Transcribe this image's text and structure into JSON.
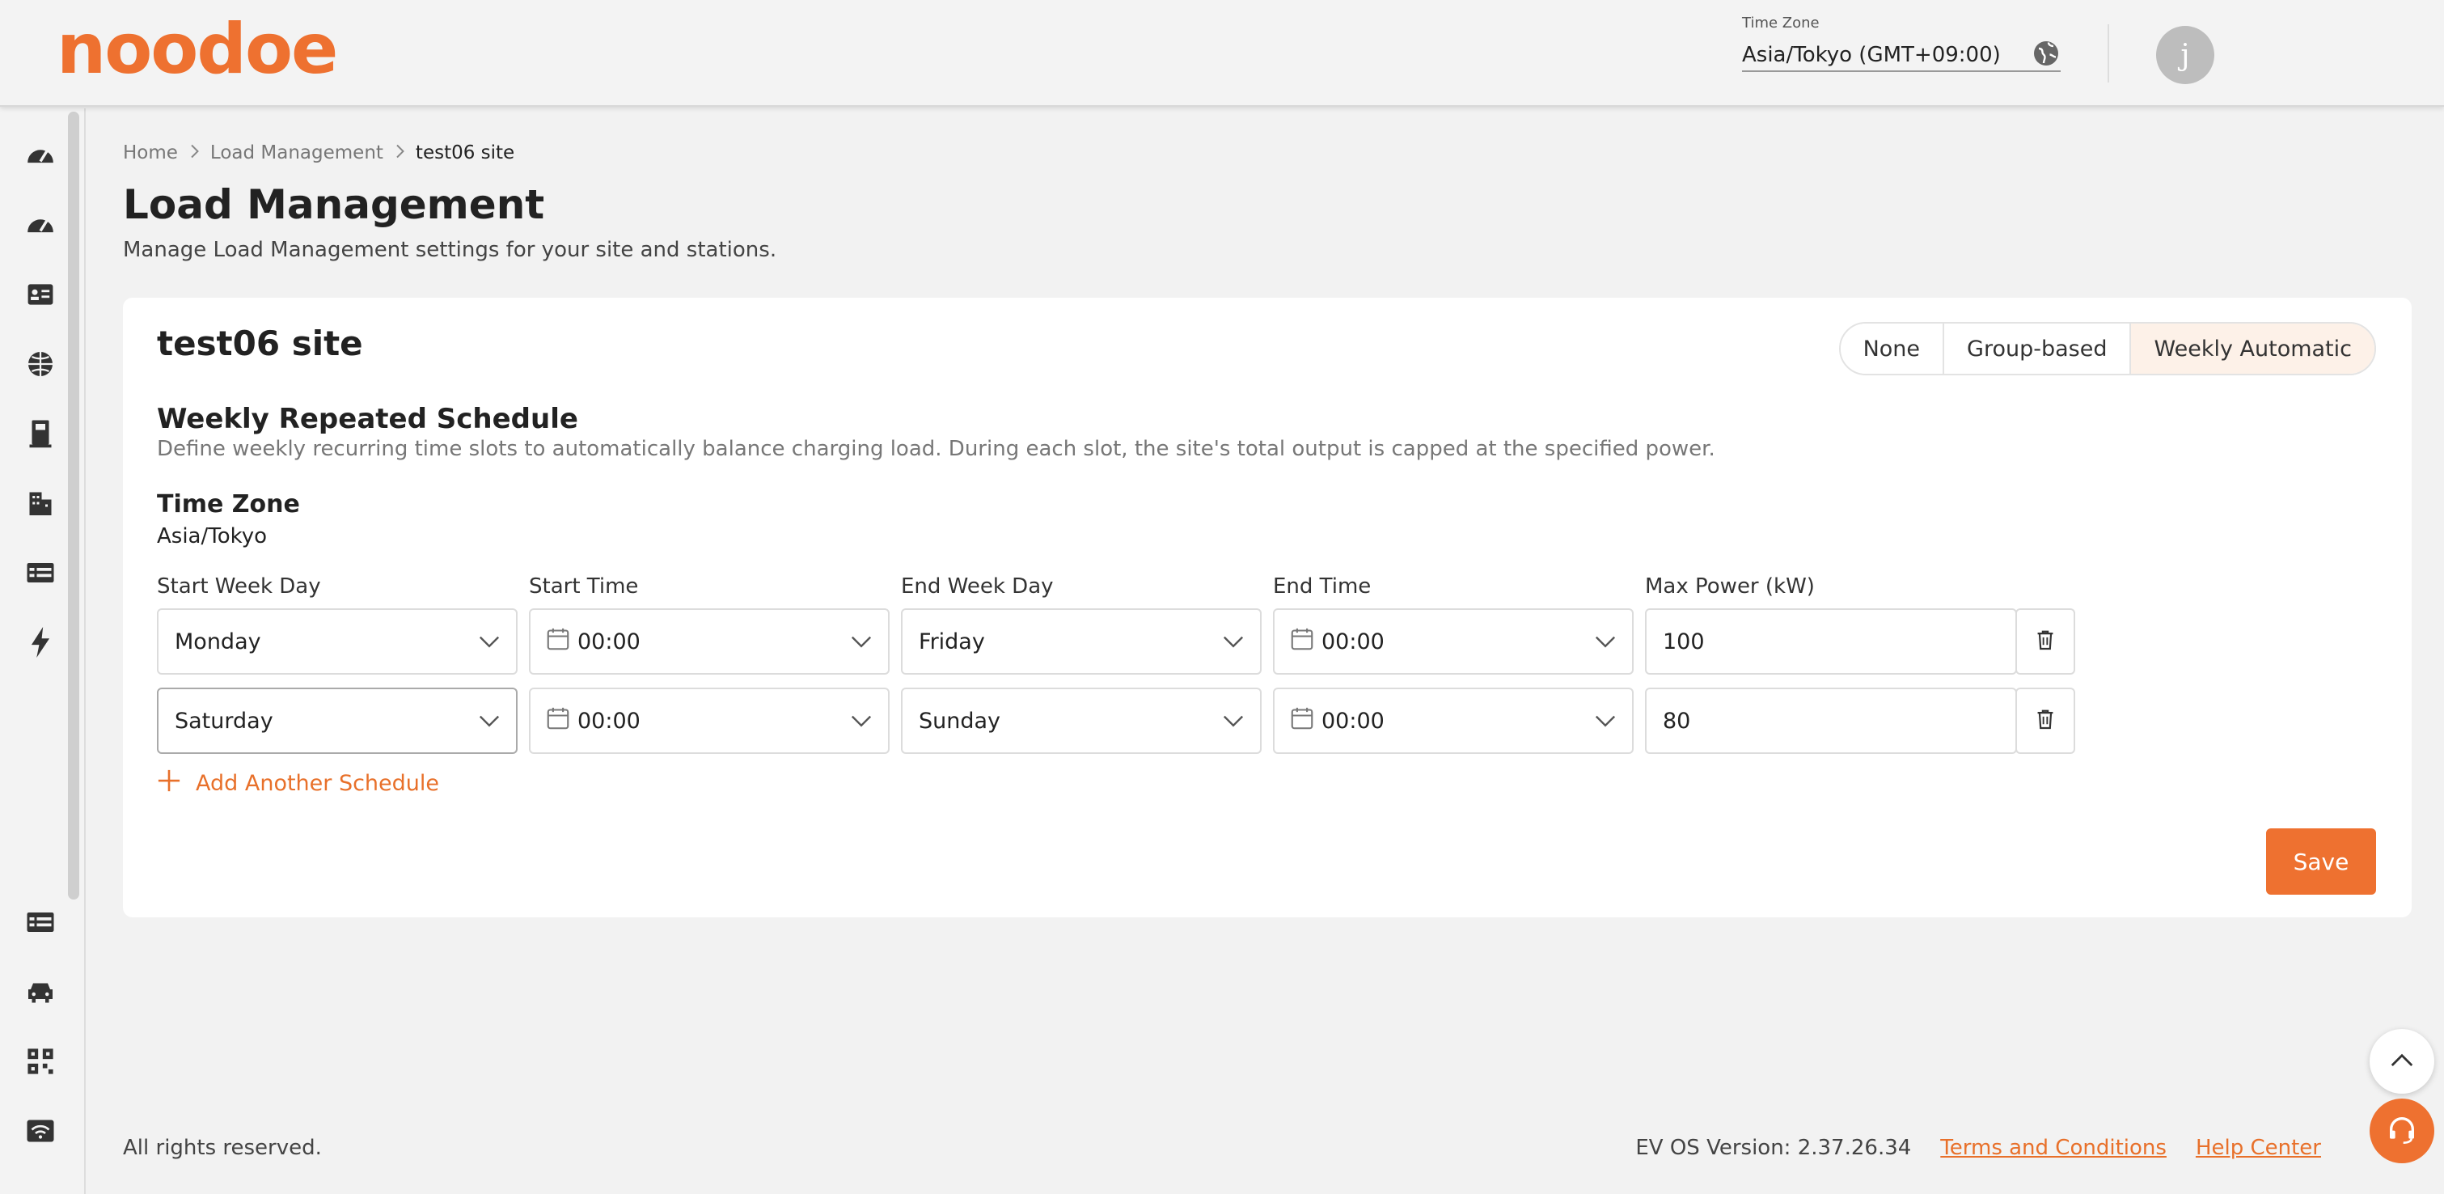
{
  "header": {
    "logo_text": "noodoe",
    "timezone_label": "Time Zone",
    "timezone_value": "Asia/Tokyo (GMT+09:00)",
    "avatar_initial": "j"
  },
  "sidebar": {
    "icons": [
      "dashboard-icon",
      "dashboard-alt-icon",
      "id-card-icon",
      "globe-icon",
      "charger-icon",
      "building-icon",
      "table-icon",
      "lightning-icon",
      "list-icon",
      "car-icon",
      "qr-code-icon",
      "wifi-icon"
    ]
  },
  "breadcrumb": {
    "home": "Home",
    "section": "Load Management",
    "current": "test06 site"
  },
  "page": {
    "title": "Load Management",
    "subtitle": "Manage Load Management settings for your site and stations."
  },
  "card": {
    "site_title": "test06 site",
    "modes": [
      "None",
      "Group-based",
      "Weekly Automatic"
    ],
    "selected_mode": "Weekly Automatic",
    "section_title": "Weekly Repeated Schedule",
    "section_desc": "Define weekly recurring time slots to automatically balance charging load. During each slot, the site's total output is capped at the specified power.",
    "tz_title": "Time Zone",
    "tz_value": "Asia/Tokyo",
    "columns": {
      "start_day": "Start Week Day",
      "start_time": "Start Time",
      "end_day": "End Week Day",
      "end_time": "End Time",
      "max_power": "Max Power (kW)"
    },
    "schedules": [
      {
        "start_day": "Monday",
        "start_time": "00:00",
        "end_day": "Friday",
        "end_time": "00:00",
        "max_power": "100"
      },
      {
        "start_day": "Saturday",
        "start_time": "00:00",
        "end_day": "Sunday",
        "end_time": "00:00",
        "max_power": "80"
      }
    ],
    "add_label": "Add Another Schedule",
    "save_label": "Save"
  },
  "footer": {
    "rights": "All rights reserved.",
    "version": "EV OS Version: 2.37.26.34",
    "terms": "Terms and Conditions",
    "help": "Help Center"
  },
  "colors": {
    "accent": "#ee7130",
    "background": "#f2f2f2"
  }
}
